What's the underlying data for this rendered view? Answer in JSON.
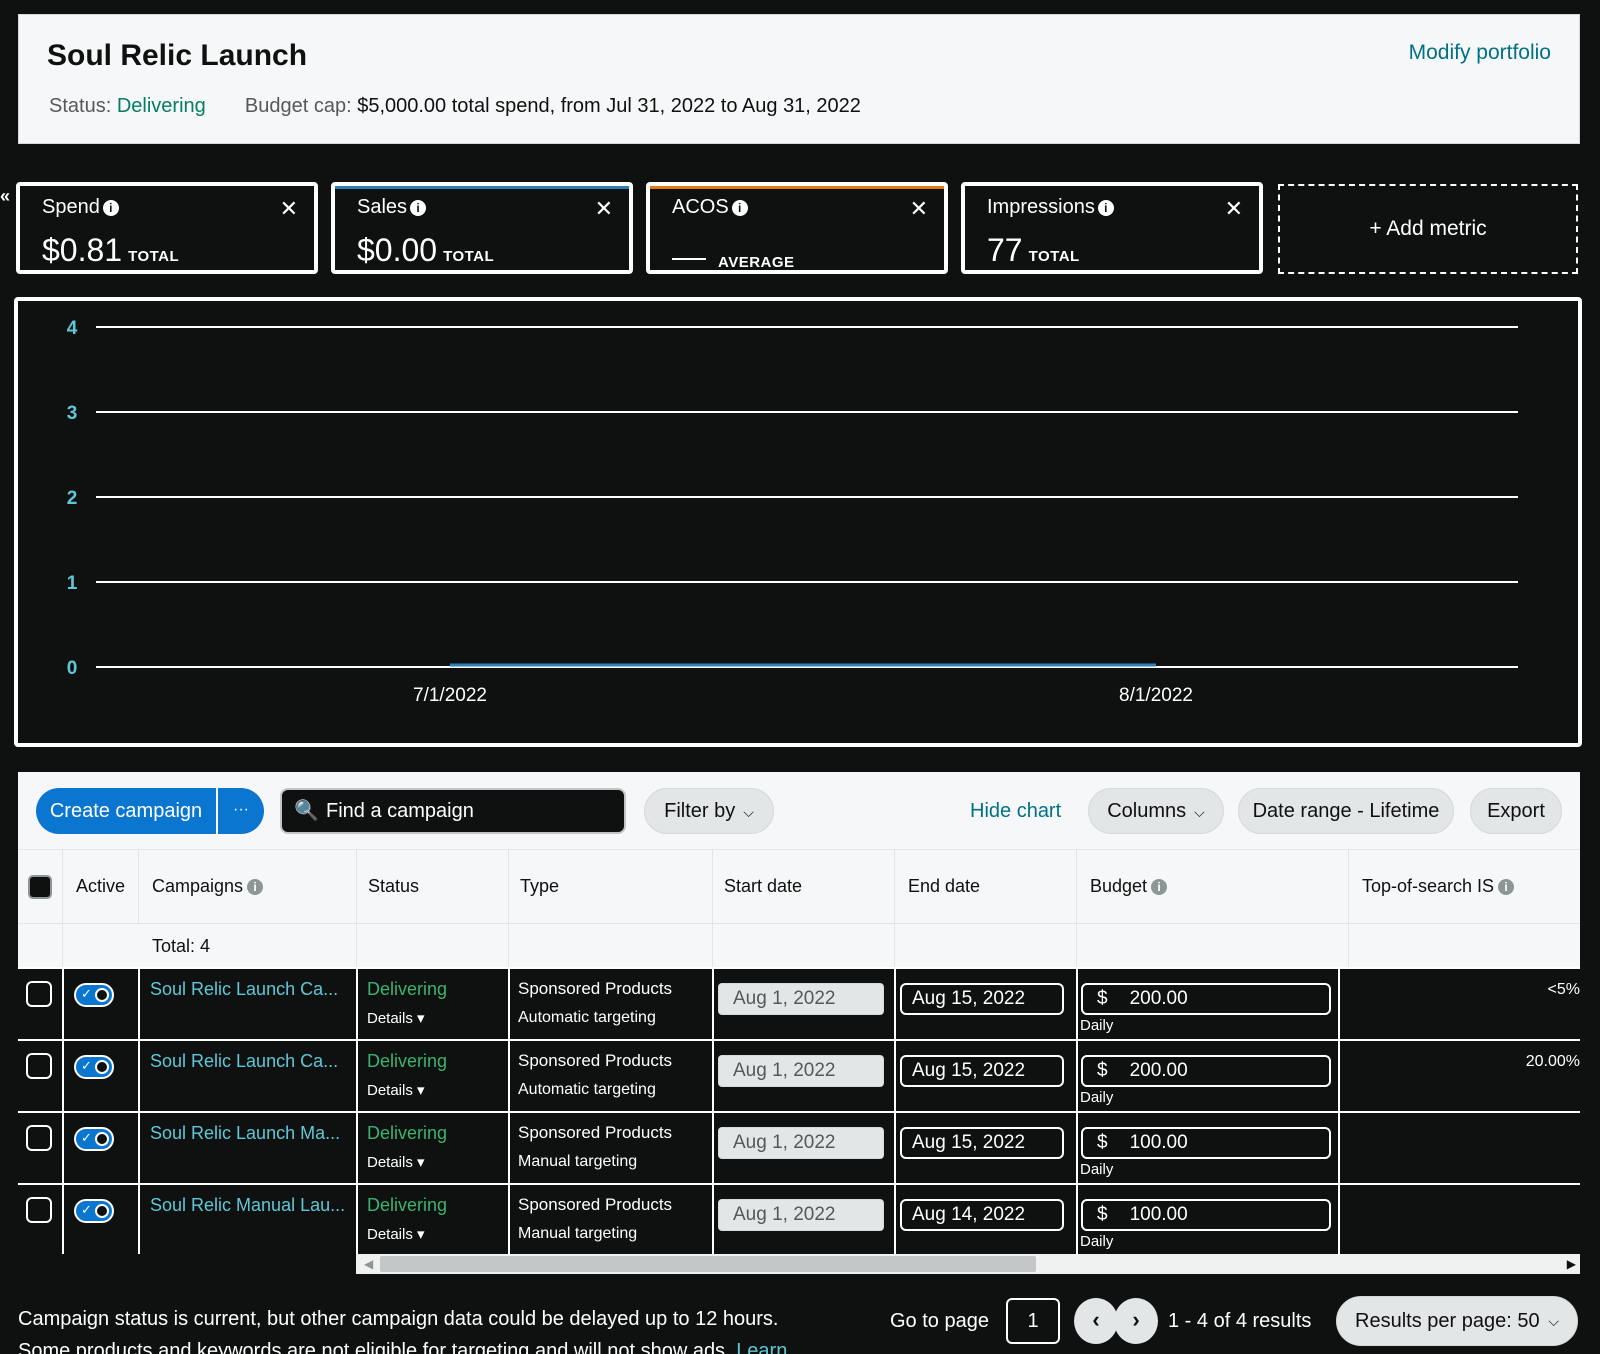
{
  "header": {
    "title": "Soul Relic Launch",
    "modify_link": "Modify portfolio",
    "status_label": "Status:",
    "status_value": "Delivering",
    "budget_label": "Budget cap:",
    "budget_value": "$5,000.00 total spend, from Jul 31, 2022 to Aug 31, 2022"
  },
  "collapse_glyph": "«",
  "metrics": [
    {
      "label": "Spend",
      "value": "$0.81",
      "unit": "TOTAL",
      "accent": "#ffffff"
    },
    {
      "label": "Sales",
      "value": "$0.00",
      "unit": "TOTAL",
      "accent": "#2c7fb8"
    },
    {
      "label": "ACOS",
      "value": "",
      "unit": "AVERAGE",
      "accent": "#e47911"
    },
    {
      "label": "Impressions",
      "value": "77",
      "unit": "TOTAL",
      "accent": "#ffffff"
    }
  ],
  "metric_info_glyph": "i",
  "metric_close_glyph": "✕",
  "add_metric": "+ Add metric",
  "chart_data": {
    "type": "line",
    "x_tick_labels": [
      "7/1/2022",
      "8/1/2022"
    ],
    "y_tick_labels": [
      "0",
      "1",
      "2",
      "3",
      "4"
    ],
    "ylim": [
      0,
      4
    ],
    "grid": true,
    "series": [
      {
        "x": [
          "7/1/2022",
          "8/1/2022"
        ],
        "values": [
          0,
          0
        ],
        "color": "#2c7fb8"
      }
    ]
  },
  "toolbar": {
    "create_campaign": "Create campaign",
    "more": "···",
    "search_placeholder": "Find a campaign",
    "filter_by": "Filter by",
    "hide_chart": "Hide chart",
    "columns": "Columns",
    "date_range": "Date range - Lifetime",
    "export": "Export"
  },
  "table": {
    "headers": {
      "active": "Active",
      "campaigns": "Campaigns",
      "status": "Status",
      "type": "Type",
      "start_date": "Start date",
      "end_date": "End date",
      "budget": "Budget",
      "tos": "Top-of-search IS"
    },
    "total_label": "Total: 4",
    "rows": [
      {
        "campaign": "Soul Relic Launch Ca...",
        "status": "Delivering",
        "details": "Details ▾",
        "type1": "Sponsored Products",
        "type2": "Automatic targeting",
        "start": "Aug 1, 2022",
        "end": "Aug 15, 2022",
        "currency": "$",
        "budget": "200.00",
        "budget_type": "Daily",
        "tos": "<5%"
      },
      {
        "campaign": "Soul Relic Launch Ca...",
        "status": "Delivering",
        "details": "Details ▾",
        "type1": "Sponsored Products",
        "type2": "Automatic targeting",
        "start": "Aug 1, 2022",
        "end": "Aug 15, 2022",
        "currency": "$",
        "budget": "200.00",
        "budget_type": "Daily",
        "tos": "20.00%"
      },
      {
        "campaign": "Soul Relic Launch Ma...",
        "status": "Delivering",
        "details": "Details ▾",
        "type1": "Sponsored Products",
        "type2": "Manual targeting",
        "start": "Aug 1, 2022",
        "end": "Aug 15, 2022",
        "currency": "$",
        "budget": "100.00",
        "budget_type": "Daily",
        "tos": ""
      },
      {
        "campaign": "Soul Relic Manual Lau...",
        "status": "Delivering",
        "details": "Details ▾",
        "type1": "Sponsored Products",
        "type2": "Manual targeting",
        "start": "Aug 1, 2022",
        "end": "Aug 14, 2022",
        "currency": "$",
        "budget": "100.00",
        "budget_type": "Daily",
        "tos": ""
      }
    ]
  },
  "footer": {
    "note1": "Campaign status is current, but other campaign data could be delayed up to 12 hours.",
    "note2": "Some products and keywords are not eligible for targeting and will not show ads.",
    "note2_link": "Learn",
    "goto_label": "Go to page",
    "goto_value": "1",
    "prev": "‹",
    "next": "›",
    "results": "1 - 4 of 4 results",
    "per_page": "Results per page: 50"
  }
}
